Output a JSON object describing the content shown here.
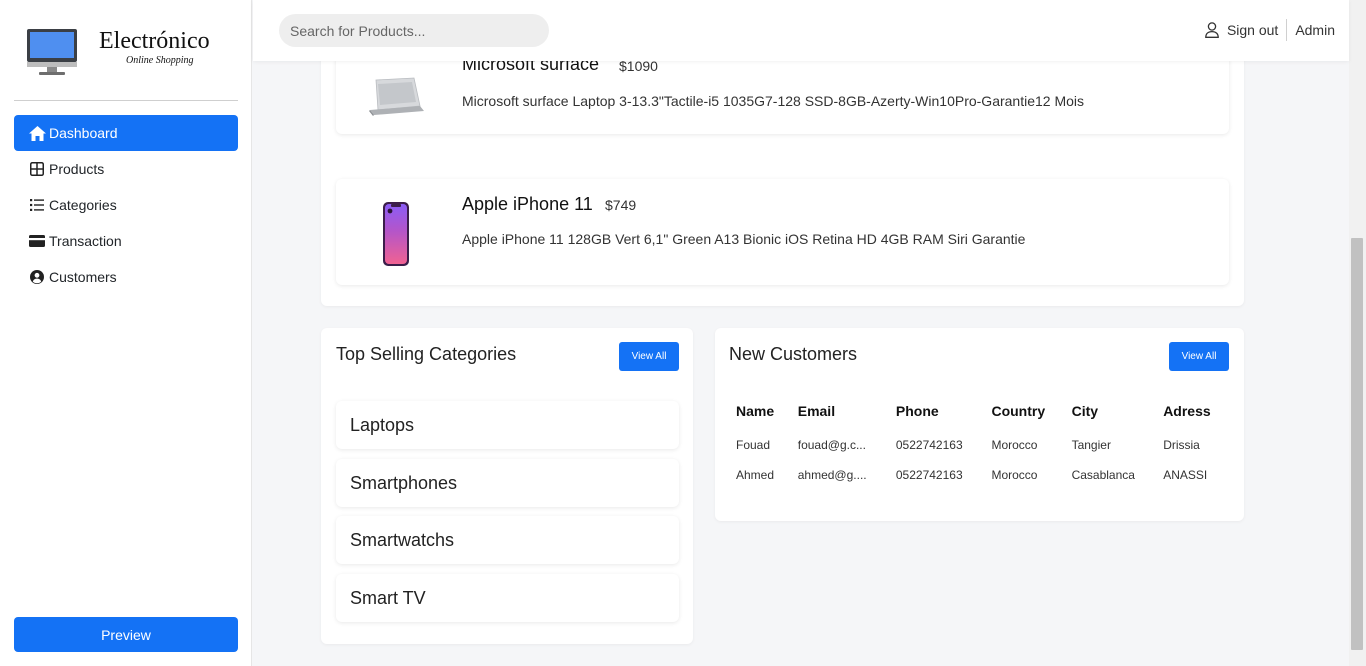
{
  "brand": {
    "title": "Electrónico",
    "subtitle": "Online Shopping"
  },
  "sidebar": {
    "items": [
      {
        "label": "Dashboard",
        "icon": "home-icon",
        "active": true
      },
      {
        "label": "Products",
        "icon": "grid-icon",
        "active": false
      },
      {
        "label": "Categories",
        "icon": "list-icon",
        "active": false
      },
      {
        "label": "Transaction",
        "icon": "credit-card-icon",
        "active": false
      },
      {
        "label": "Customers",
        "icon": "user-circle-icon",
        "active": false
      }
    ],
    "preview_label": "Preview"
  },
  "topbar": {
    "search_placeholder": "Search for Products...",
    "sign_out_label": "Sign out",
    "admin_label": "Admin"
  },
  "products": [
    {
      "name": "Microsoft surface",
      "price": "$1090",
      "description": "Microsoft surface Laptop 3-13.3\"Tactile-i5 1035G7-128 SSD-8GB-Azerty-Win10Pro-Garantie12 Mois",
      "image": "laptop"
    },
    {
      "name": "Apple iPhone 11",
      "price": "$749",
      "description": "Apple iPhone 11 128GB Vert 6,1\" Green A13 Bionic iOS Retina HD 4GB RAM Siri Garantie",
      "image": "smartphone"
    }
  ],
  "categories_card": {
    "title": "Top Selling Categories",
    "view_all_label": "View All",
    "items": [
      "Laptops",
      "Smartphones",
      "Smartwatchs",
      "Smart TV"
    ]
  },
  "customers_card": {
    "title": "New Customers",
    "view_all_label": "View All",
    "columns": [
      "Name",
      "Email",
      "Phone",
      "Country",
      "City",
      "Adress"
    ],
    "rows": [
      [
        "Fouad",
        "fouad@g.c...",
        "0522742163",
        "Morocco",
        "Tangier",
        "Drissia"
      ],
      [
        "Ahmed",
        "ahmed@g....",
        "0522742163",
        "Morocco",
        "Casablanca",
        "ANASSI"
      ]
    ]
  },
  "colors": {
    "primary": "#1472f5",
    "background": "#f5f6f8"
  }
}
